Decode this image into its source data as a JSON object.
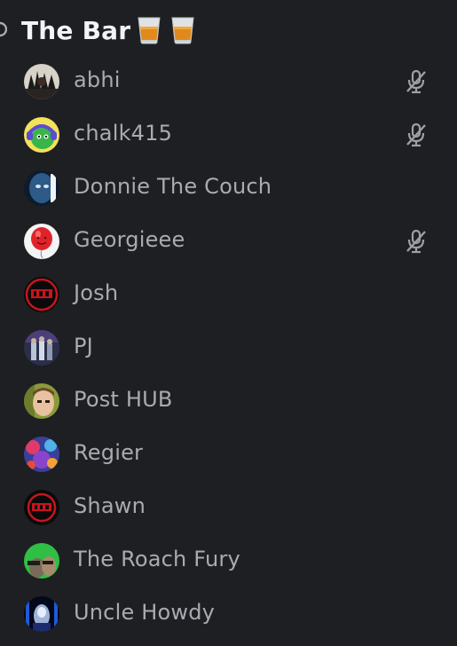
{
  "channel": {
    "name": "The Bar",
    "icon": "speaker-icon",
    "emoji": [
      "tumbler-glass",
      "tumbler-glass"
    ]
  },
  "users": [
    {
      "name": "abhi",
      "muted": true
    },
    {
      "name": "chalk415",
      "muted": true
    },
    {
      "name": "Donnie The Couch",
      "muted": false
    },
    {
      "name": "Georgieee",
      "muted": true
    },
    {
      "name": "Josh",
      "muted": false
    },
    {
      "name": "PJ",
      "muted": false
    },
    {
      "name": "Post HUB",
      "muted": false
    },
    {
      "name": "Regier",
      "muted": false
    },
    {
      "name": "Shawn",
      "muted": false
    },
    {
      "name": "The Roach Fury",
      "muted": false
    },
    {
      "name": "Uncle Howdy",
      "muted": false
    }
  ],
  "colors": {
    "background": "#1e1f22",
    "channel_text": "#f2f3f5",
    "username_text": "#a9abb2",
    "mute_icon": "#9ea0a6"
  }
}
